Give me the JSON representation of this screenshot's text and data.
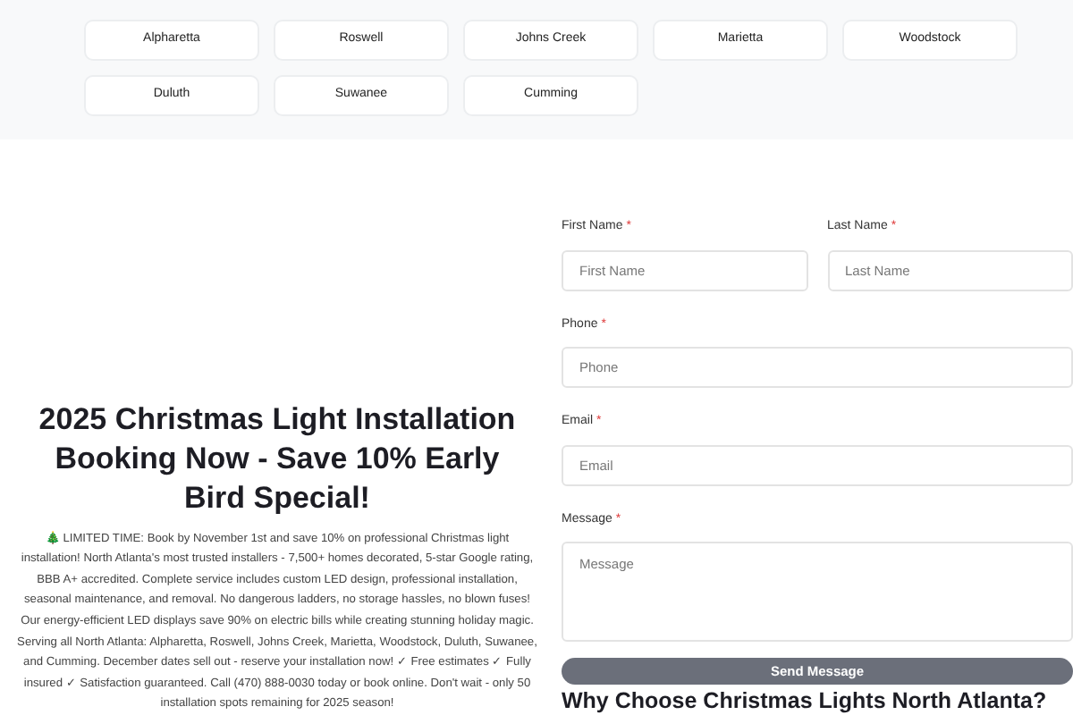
{
  "cities": [
    "Alpharetta",
    "Roswell",
    "Johns Creek",
    "Marietta",
    "Woodstock",
    "Duluth",
    "Suwanee",
    "Cumming"
  ],
  "hero": {
    "title": "2025 Christmas Light Installation Booking Now - Save 10% Early Bird Special!",
    "body": "🎄 LIMITED TIME: Book by November 1st and save 10% on professional Christmas light installation! North Atlanta's most trusted installers - 7,500+ homes decorated, 5-star Google rating, BBB A+ accredited. Complete service includes custom LED design, professional installation, seasonal maintenance, and removal. No dangerous ladders, no storage hassles, no blown fuses! Our energy-efficient LED displays save 90% on electric bills while creating stunning holiday magic. Serving all North Atlanta: Alpharetta, Roswell, Johns Creek, Marietta, Woodstock, Duluth, Suwanee, and Cumming. December dates sell out - reserve your installation now! ✓ Free estimates ✓ Fully insured ✓ Satisfaction guaranteed. Call (470) 888-0030 today or book online. Don't wait - only 50 installation spots remaining for 2025 season!"
  },
  "form": {
    "fields": [
      {
        "kind": "input",
        "label": "First Name",
        "required_mark": "*",
        "placeholder": "First Name"
      },
      {
        "kind": "input",
        "label": "Last Name",
        "required_mark": "*",
        "placeholder": "Last Name"
      },
      {
        "kind": "input",
        "label": "Phone",
        "required_mark": "*",
        "placeholder": "Phone"
      },
      {
        "kind": "input",
        "label": "Email",
        "required_mark": "*",
        "placeholder": "Email"
      },
      {
        "kind": "textarea",
        "label": "Message",
        "required_mark": "*",
        "placeholder": "Message"
      }
    ],
    "submit": "Send Message"
  },
  "why_heading": "Why Choose Christmas Lights North Atlanta?"
}
